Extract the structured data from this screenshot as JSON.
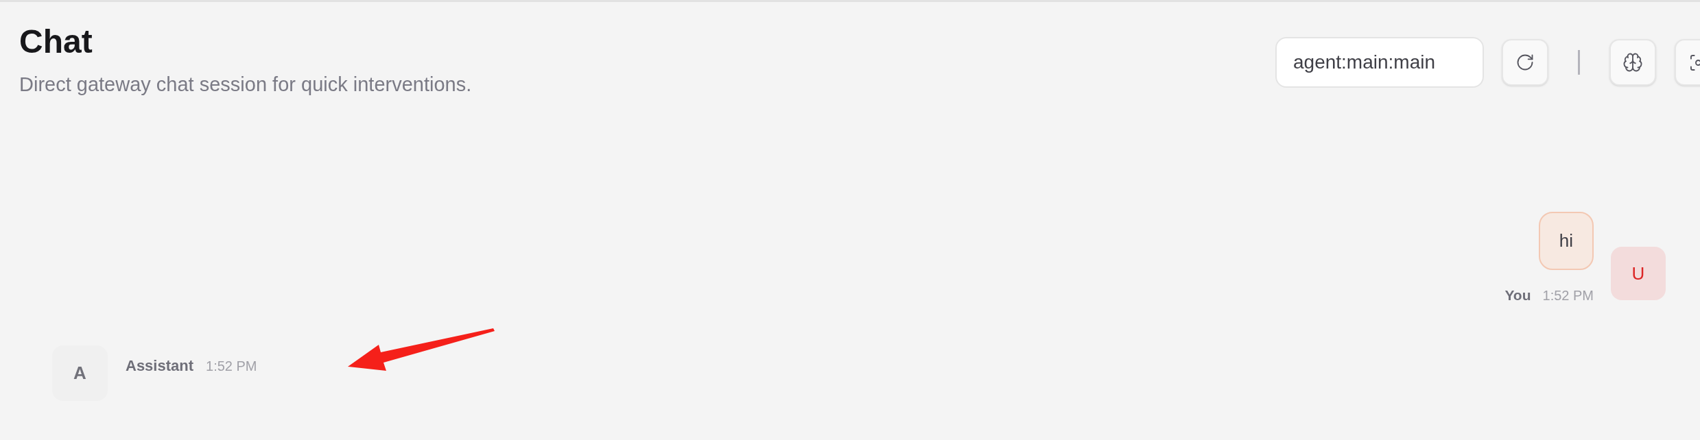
{
  "header": {
    "title": "Chat",
    "subtitle": "Direct gateway chat session for quick interventions."
  },
  "toolbar": {
    "session": {
      "value": "agent:main:main"
    },
    "items": [
      {
        "kind": "refresh"
      },
      {
        "kind": "divider"
      },
      {
        "kind": "brain"
      },
      {
        "kind": "focus"
      }
    ]
  },
  "messages": [
    {
      "kind": "user",
      "avatar": "U",
      "text": "hi",
      "sender": "You",
      "time": "1:52 PM"
    },
    {
      "kind": "assistant",
      "avatar": "A",
      "sender": "Assistant",
      "time": "1:52 PM"
    }
  ],
  "annotations": [
    {
      "kind": "arrow"
    }
  ]
}
